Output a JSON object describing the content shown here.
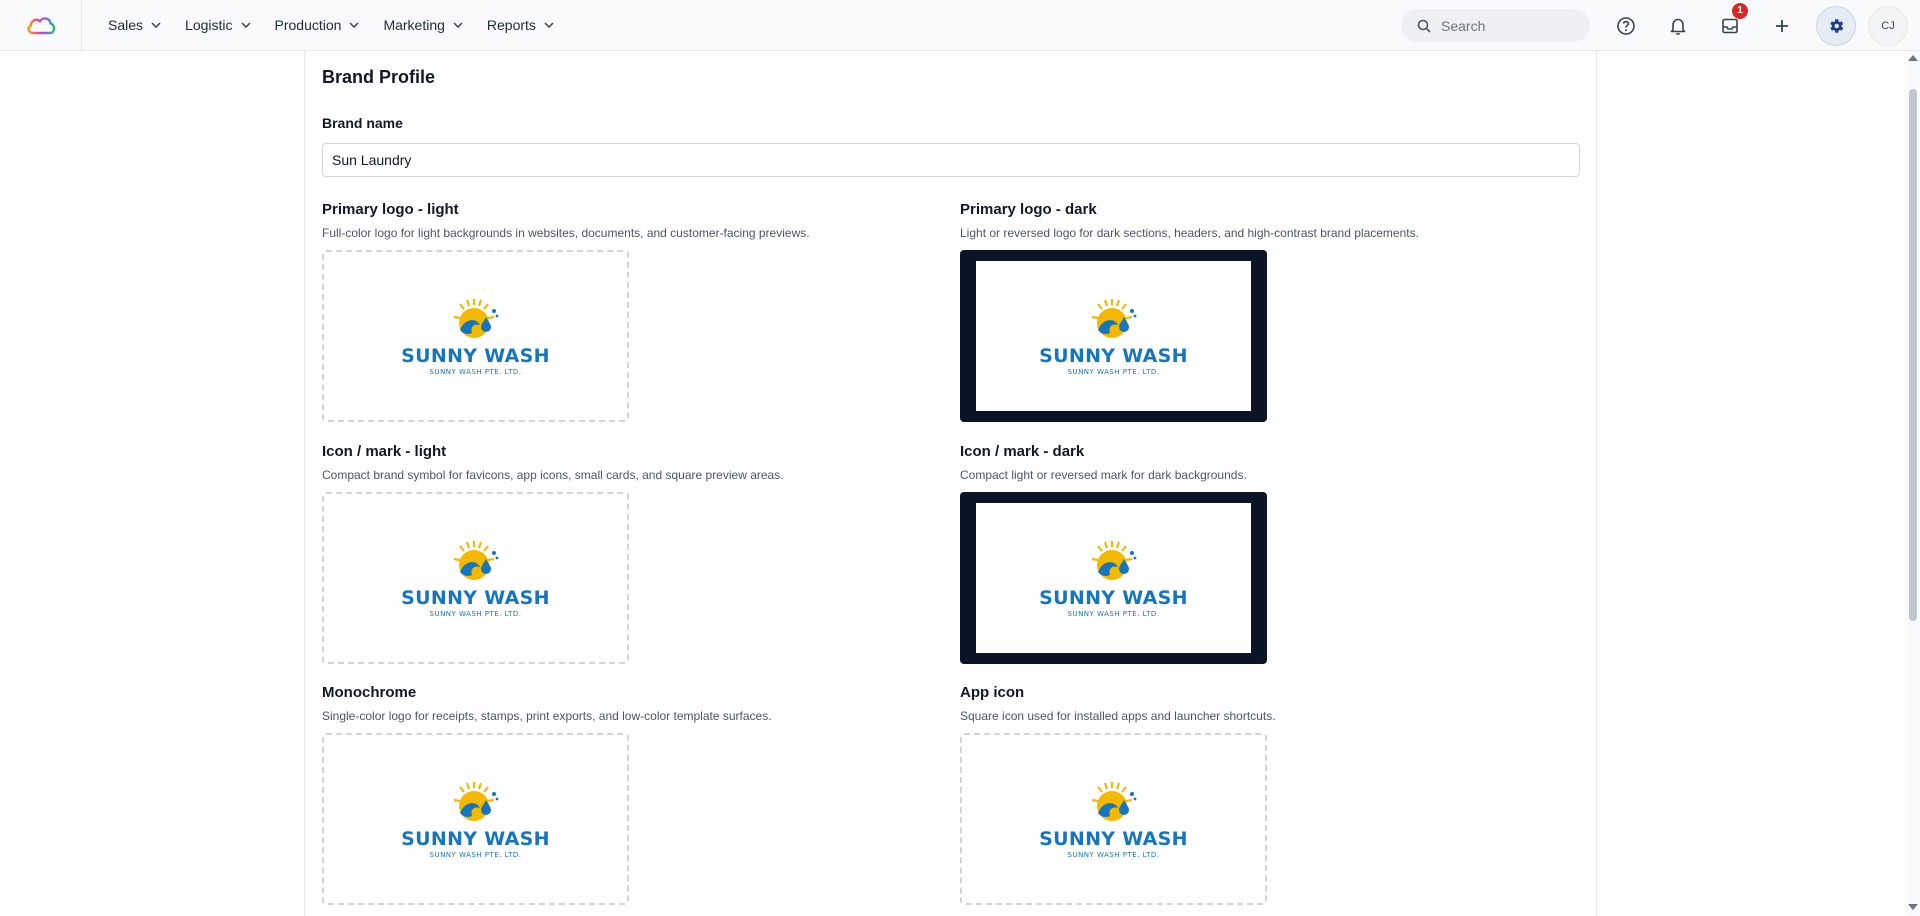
{
  "nav": {
    "menu": [
      {
        "label": "Sales"
      },
      {
        "label": "Logistic"
      },
      {
        "label": "Production"
      },
      {
        "label": "Marketing"
      },
      {
        "label": "Reports"
      }
    ],
    "search_placeholder": "Search",
    "inbox_badge": "1",
    "avatar_initials": "CJ"
  },
  "page": {
    "title": "Brand Profile",
    "brand_name_label": "Brand name",
    "brand_name_value": "Sun Laundry"
  },
  "logo_text": {
    "name": "SUNNY WASH",
    "sub": "SUNNY WASH PTE. LTD."
  },
  "cards": [
    {
      "title": "Primary logo - light",
      "desc": "Full-color logo for light backgrounds in websites, documents, and customer-facing previews.",
      "variant": "light"
    },
    {
      "title": "Primary logo - dark",
      "desc": "Light or reversed logo for dark sections, headers, and high-contrast brand placements.",
      "variant": "dark"
    },
    {
      "title": "Icon / mark - light",
      "desc": "Compact brand symbol for favicons, app icons, small cards, and square preview areas.",
      "variant": "light"
    },
    {
      "title": "Icon / mark - dark",
      "desc": "Compact light or reversed mark for dark backgrounds.",
      "variant": "dark"
    },
    {
      "title": "Monochrome",
      "desc": "Single-color logo for receipts, stamps, print exports, and low-color template surfaces.",
      "variant": "light"
    },
    {
      "title": "App icon",
      "desc": "Square icon used for installed apps and launcher shortcuts.",
      "variant": "light"
    }
  ],
  "colors": {
    "brand_blue": "#1576bd",
    "sun_yellow": "#f5b800",
    "dark_bg": "#0b1427",
    "badge_red": "#dc2626"
  }
}
